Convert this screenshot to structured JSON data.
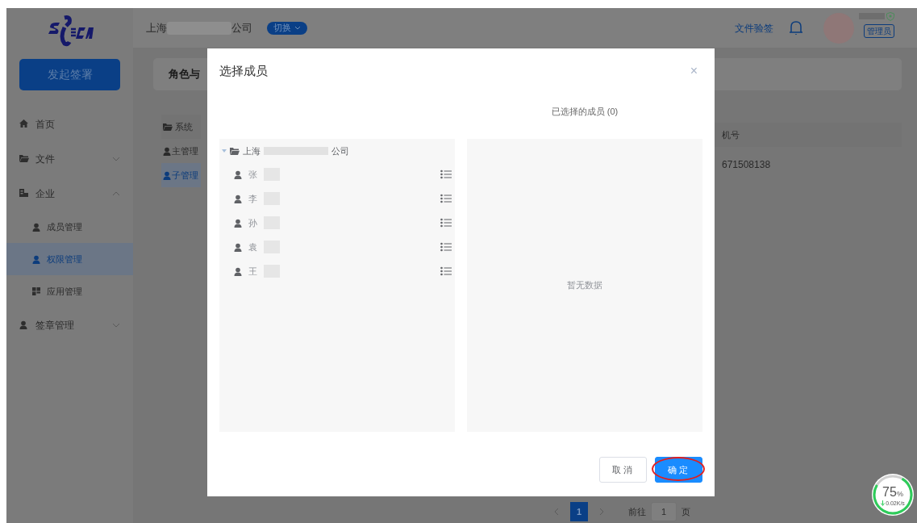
{
  "header": {
    "company_prefix": "上海",
    "company_suffix": "公司",
    "switch_button": "切换",
    "verify_link": "文件验签",
    "role_badge": "管理员"
  },
  "sidebar": {
    "primary_button": "发起签署",
    "items": [
      {
        "label": "首页",
        "kind": "link",
        "selected": false
      },
      {
        "label": "文件",
        "kind": "group",
        "selected": false,
        "expanded": false
      },
      {
        "label": "企业",
        "kind": "group",
        "selected": false,
        "expanded": true,
        "children": [
          {
            "label": "成员管理",
            "selected": false
          },
          {
            "label": "权限管理",
            "selected": true
          },
          {
            "label": "应用管理",
            "selected": false
          }
        ]
      },
      {
        "label": "签章管理",
        "kind": "group",
        "selected": false,
        "expanded": false
      }
    ]
  },
  "page": {
    "card_title": "角色与",
    "roles_header": "系统",
    "roles": [
      {
        "label": "主管理",
        "selected": false
      },
      {
        "label": "子管理",
        "selected": true
      }
    ],
    "table": {
      "columns": [
        "机号"
      ],
      "rows": [
        [
          "671508138"
        ]
      ]
    }
  },
  "pagination": {
    "pages": [
      {
        "label": "1",
        "selected": true
      }
    ],
    "goto_label": "前往",
    "goto_value": "1",
    "page_suffix": "页"
  },
  "dialog": {
    "title": "选择成员",
    "close": "×",
    "selected_heading": "已选择的成员 (0)",
    "tree": {
      "label_prefix": "上海",
      "label_suffix": "公司",
      "expanded": true,
      "children": [
        {
          "label": "张"
        },
        {
          "label": "李"
        },
        {
          "label": "孙"
        },
        {
          "label": "袁"
        },
        {
          "label": "王"
        }
      ]
    },
    "empty_text": "暂无数据",
    "buttons": [
      {
        "label": "取消",
        "kind": "default",
        "circled": false
      },
      {
        "label": "确定",
        "kind": "primary",
        "circled": true
      }
    ]
  },
  "speed_widget": {
    "percent": "75",
    "unit": "%",
    "rate": "0.02K/s"
  }
}
